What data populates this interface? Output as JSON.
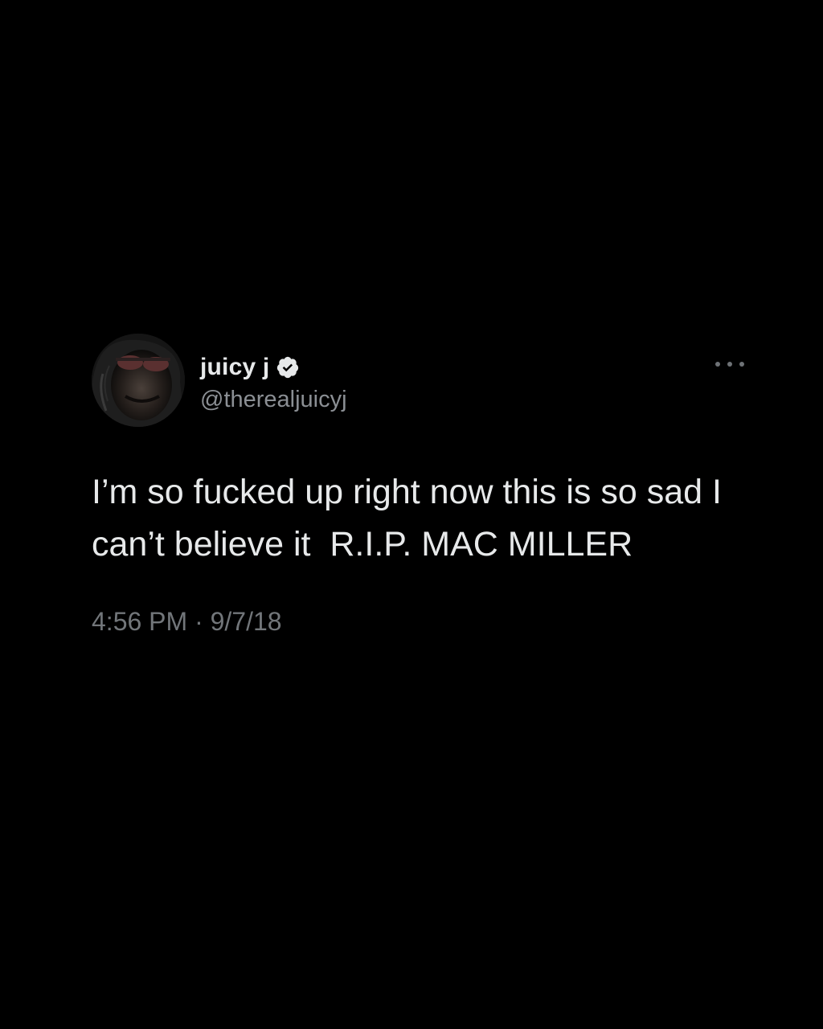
{
  "tweet": {
    "author": {
      "display_name": "juicy j",
      "handle": "@therealjuicyj",
      "verified": true
    },
    "text": "I’m so fucked up right now this is so sad I can’t believe it  R.I.P. MAC MILLER",
    "time": "4:56 PM",
    "separator": "·",
    "date": "9/7/18",
    "more_icon": "more-horizontal-icon",
    "verified_icon": "verified-badge-icon"
  },
  "colors": {
    "background": "#000000",
    "text": "#e7e9ea",
    "secondary": "#8b8f94",
    "verified_badge": "#e7e9ea"
  }
}
